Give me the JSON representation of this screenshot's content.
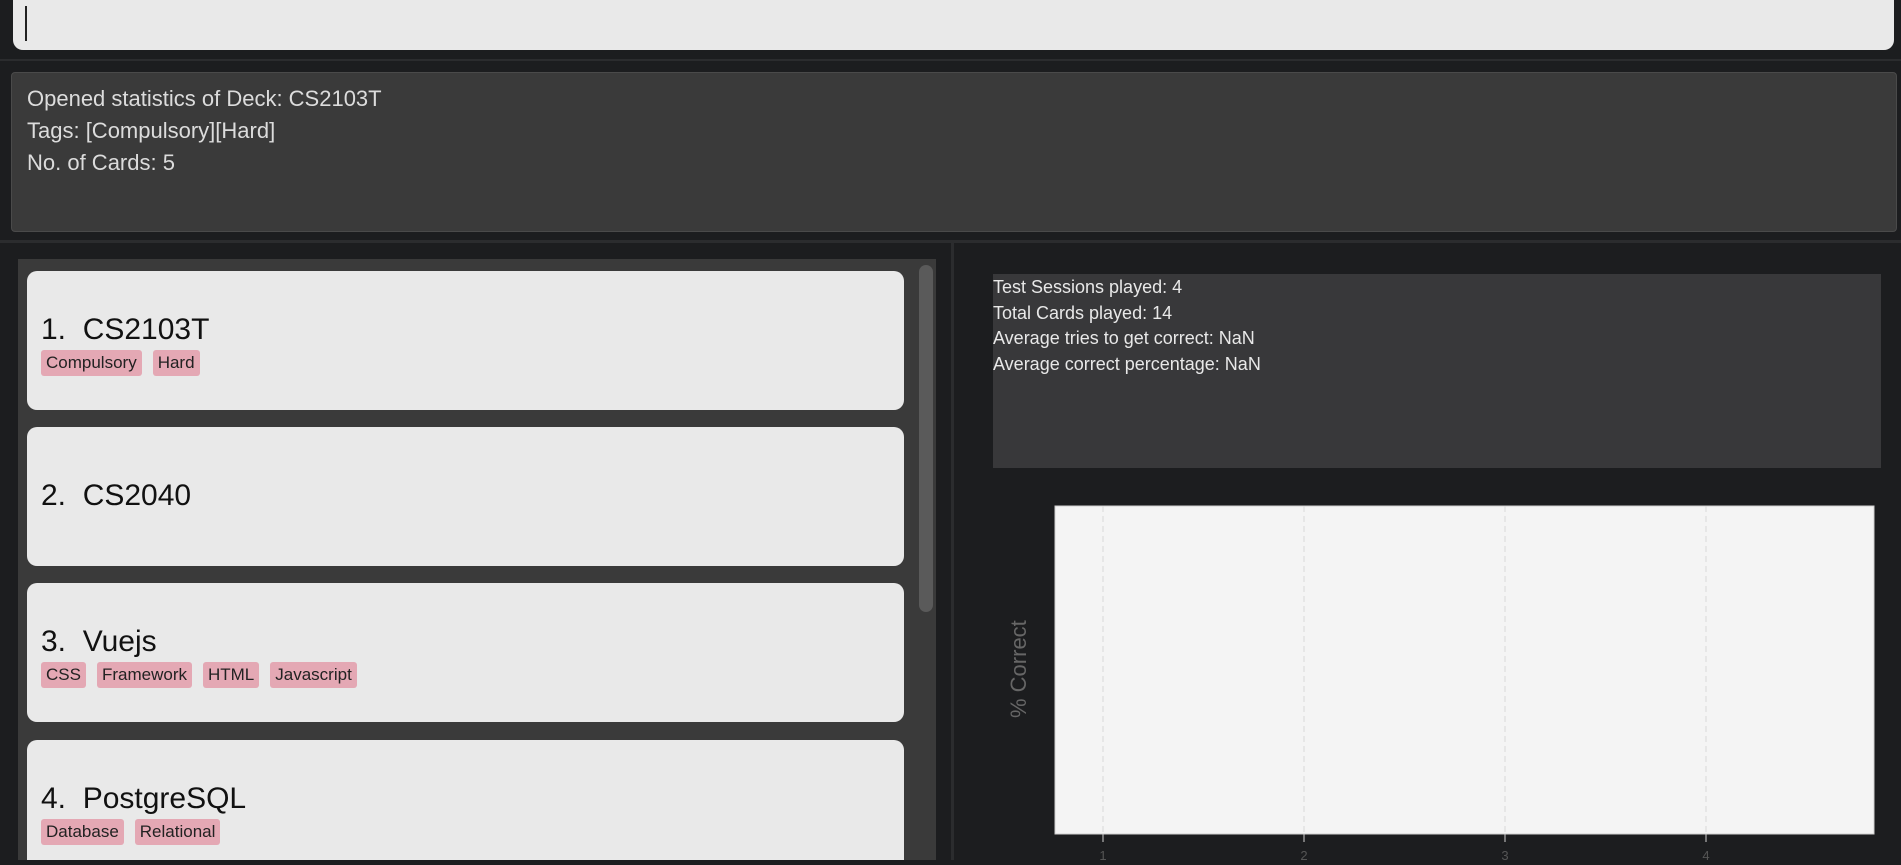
{
  "command_box": {
    "value": ""
  },
  "result_display": {
    "lines": [
      "Opened statistics of Deck: CS2103T",
      "Tags: [Compulsory][Hard]",
      "No. of Cards: 5"
    ]
  },
  "deck_list": {
    "decks": [
      {
        "title": "1.  CS2103T",
        "tags": [
          "Compulsory",
          "Hard"
        ]
      },
      {
        "title": "2.  CS2040",
        "tags": []
      },
      {
        "title": "3.  Vuejs",
        "tags": [
          "CSS",
          "Framework",
          "HTML",
          "Javascript"
        ]
      },
      {
        "title": "4.  PostgreSQL",
        "tags": [
          "Database",
          "Relational"
        ]
      }
    ]
  },
  "statistics": {
    "lines": [
      "Test Sessions played: 4",
      "Total Cards played: 14",
      "Average tries to get correct: NaN",
      "Average correct percentage: NaN"
    ]
  },
  "chart_data": {
    "type": "line",
    "title": "",
    "xlabel": "",
    "ylabel": "% Correct",
    "x_ticks": [
      "1",
      "2",
      "3",
      "4"
    ],
    "series": [],
    "grid": true,
    "colors": {
      "plot_background": "#f4f4f4",
      "gridline": "#d8d8d8"
    }
  },
  "colors": {
    "background": "#1c1d1f",
    "panel": "#3a3a3a",
    "card": "#e9e9e9",
    "tag": "#e4a8b4"
  }
}
